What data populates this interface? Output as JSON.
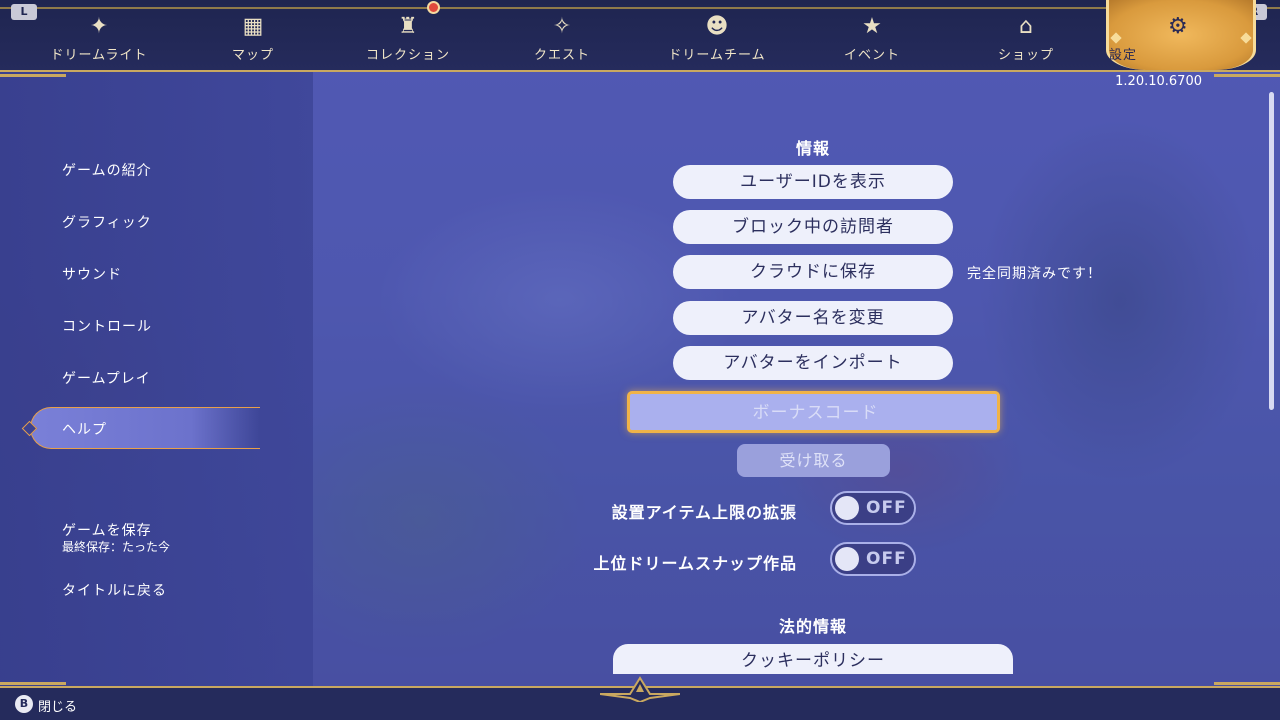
{
  "topbar": {
    "left_shoulder": "L",
    "right_shoulder": "R",
    "tabs": [
      {
        "label": "ドリームライト",
        "icon": "dreamlight-icon",
        "glyph": "✦"
      },
      {
        "label": "マップ",
        "icon": "map-icon",
        "glyph": "▦"
      },
      {
        "label": "コレクション",
        "icon": "collection-icon",
        "glyph": "♜"
      },
      {
        "label": "クエスト",
        "icon": "quest-icon",
        "glyph": "✧"
      },
      {
        "label": "ドリームチーム",
        "icon": "dream-team-icon",
        "glyph": "☻"
      },
      {
        "label": "イベント",
        "icon": "event-icon",
        "glyph": "★"
      },
      {
        "label": "ショップ",
        "icon": "shop-icon",
        "glyph": "⌂"
      },
      {
        "label": "設定",
        "icon": "gear-icon",
        "glyph": "⚙"
      }
    ],
    "active_tab": "設定"
  },
  "version": "1.20.10.6700",
  "sidebar": {
    "items": [
      {
        "label": "ゲームの紹介"
      },
      {
        "label": "グラフィック"
      },
      {
        "label": "サウンド"
      },
      {
        "label": "コントロール"
      },
      {
        "label": "ゲームプレイ"
      },
      {
        "label": "ヘルプ"
      }
    ],
    "active_item": "ヘルプ",
    "save_label": "ゲームを保存",
    "last_saved": "最終保存：たった今",
    "return_title": "タイトルに戻る"
  },
  "main": {
    "info_title": "情報",
    "buttons": {
      "show_user_id": "ユーザーIDを表示",
      "blocked_visitors": "ブロック中の訪問者",
      "cloud_save": "クラウドに保存",
      "change_avatar_name": "アバター名を変更",
      "import_avatar": "アバターをインポート"
    },
    "sync_status": "完全同期済みです！",
    "bonus_code_placeholder": "ボーナスコード",
    "receive": "受け取る",
    "toggles": [
      {
        "label": "設置アイテム上限の拡張",
        "state": "OFF"
      },
      {
        "label": "上位ドリームスナップ作品",
        "state": "OFF"
      }
    ],
    "legal_title": "法的情報",
    "cookie_policy": "クッキーポリシー"
  },
  "bottombar": {
    "button_glyph": "B",
    "close_label": "閉じる"
  },
  "colors": {
    "accent_gold": "#f0b348",
    "bar_navy": "#252b5c",
    "active_tab": "#e5a64a"
  }
}
